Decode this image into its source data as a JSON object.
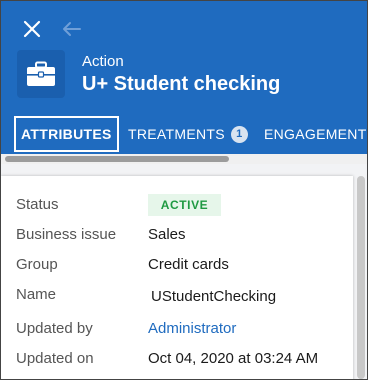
{
  "header": {
    "object_type": "Action",
    "title": "U+ Student checking",
    "background_color": "#1f6bbf",
    "icons": {
      "close": "close-icon",
      "back": "arrow-left-icon",
      "object": "briefcase-icon"
    }
  },
  "tabs": [
    {
      "label": "ATTRIBUTES",
      "active": true
    },
    {
      "label": "TREATMENTS",
      "badge": "1"
    },
    {
      "label": "ENGAGEMENT"
    }
  ],
  "attributes": {
    "status": {
      "label": "Status",
      "value": "ACTIVE",
      "color": "#1f9a42"
    },
    "business_issue": {
      "label": "Business issue",
      "value": "Sales"
    },
    "group": {
      "label": "Group",
      "value": "Credit cards"
    },
    "name": {
      "label": "Name",
      "value": "UStudentChecking"
    },
    "updated_by": {
      "label": "Updated by",
      "value": "Administrator"
    },
    "updated_on": {
      "label": "Updated on",
      "value": "Oct 04, 2020 at 03:24 AM"
    }
  }
}
